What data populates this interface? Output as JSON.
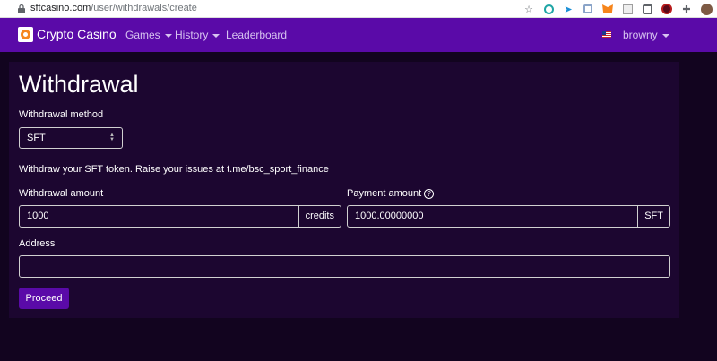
{
  "browser": {
    "url_host": "sftcasino.com",
    "url_path": "/user/withdrawals/create",
    "extension_icons": [
      "star-icon",
      "edge-e-icon",
      "arrow-icon",
      "copy-icon",
      "metamask-icon",
      "extension-box-icon",
      "tab-icon",
      "profile-icon",
      "puzzle-icon",
      "avatar-icon"
    ]
  },
  "nav": {
    "brand": "Crypto Casino",
    "items": [
      {
        "label": "Games"
      },
      {
        "label": "History"
      },
      {
        "label": "Leaderboard"
      }
    ],
    "user": "browny"
  },
  "page": {
    "title": "Withdrawal",
    "method_label": "Withdrawal method",
    "method_value": "SFT",
    "info_text": "Withdraw your SFT token. Raise your issues at t.me/bsc_sport_finance",
    "amount_label": "Withdrawal amount",
    "amount_value": "1000",
    "amount_unit": "credits",
    "payment_label": "Payment amount",
    "payment_value": "1000.00000000",
    "payment_unit": "SFT",
    "address_label": "Address",
    "address_value": "",
    "submit": "Proceed"
  },
  "colors": {
    "navbar": "#5a0aa8",
    "card": "#1c0630",
    "page_bg": "#12041f",
    "button": "#5a0aa8"
  }
}
